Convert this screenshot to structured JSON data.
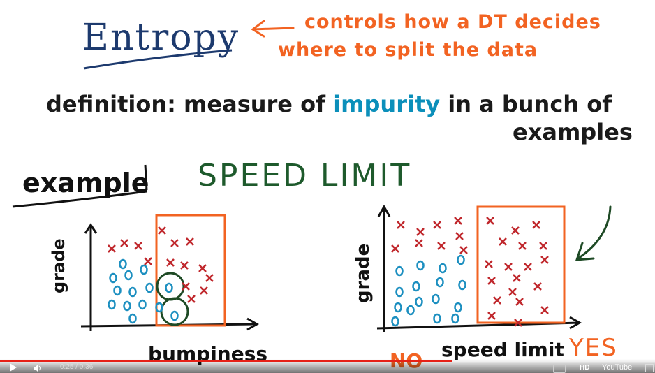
{
  "slide": {
    "title": "Entropy",
    "note_line1": "controls how a DT decides",
    "note_line2": "where to split the data",
    "definition_line1_pre": "definition: measure of ",
    "definition_highlight": "impurity",
    "definition_line1_post": " in a bunch of",
    "definition_line2": "examples",
    "example_label": "example",
    "speed_limit_label": "SPEED LIMIT"
  },
  "left_plot": {
    "y_label": "grade",
    "x_label": "bumpiness"
  },
  "right_plot": {
    "y_label": "grade",
    "x_label": "speed limit",
    "no_label": "NO",
    "yes_label": "YES"
  },
  "player": {
    "time": "0:25 / 0:36",
    "progress_fraction": 0.69,
    "logo": "YouTube",
    "hd_badge": "HD",
    "icons": [
      "play-icon",
      "volume-icon",
      "captions-icon",
      "settings-icon",
      "fullscreen-icon"
    ]
  },
  "colors": {
    "title": "#1d3a6e",
    "note": "#f26322",
    "impurity": "#0b8fba",
    "speed_limit": "#1e5a2c",
    "red_x": "#c0282d",
    "blue_o": "#1c8fc0",
    "box": "#f26322",
    "circle": "#1e4a25",
    "progress": "#e62117"
  }
}
